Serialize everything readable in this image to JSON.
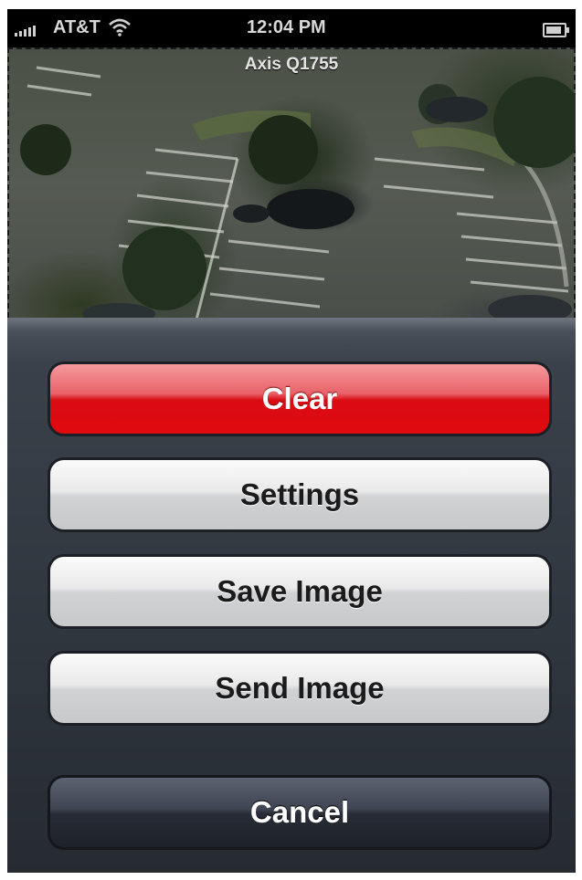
{
  "status_bar": {
    "carrier": "AT&T",
    "time": "12:04 PM",
    "wifi_icon": "wifi-icon",
    "battery_icon": "battery-icon"
  },
  "camera": {
    "title": "Axis Q1755"
  },
  "action_sheet": {
    "clear_label": "Clear",
    "settings_label": "Settings",
    "save_label": "Save Image",
    "send_label": "Send Image",
    "cancel_label": "Cancel"
  },
  "colors": {
    "destructive": "#e00a0f",
    "sheet_background": "#2f353d",
    "button_light": "#e9e9ea",
    "button_dark": "#272c36"
  }
}
